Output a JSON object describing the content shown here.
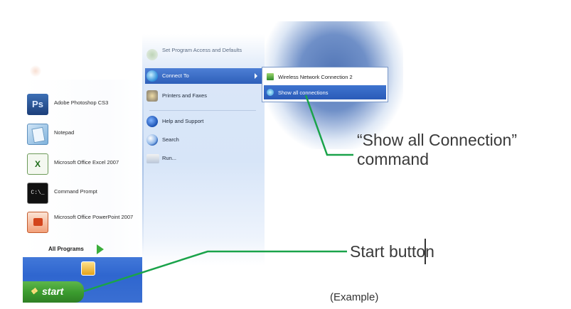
{
  "start_menu": {
    "pinned_programs": [
      {
        "label": "Adobe Photoshop CS3",
        "icon": "photoshop-icon",
        "glyph": "Ps"
      },
      {
        "label": "Notepad",
        "icon": "notepad-icon"
      },
      {
        "label": "Microsoft Office Excel 2007",
        "icon": "excel-icon",
        "glyph": "X"
      },
      {
        "label": "Command Prompt",
        "icon": "command-prompt-icon",
        "glyph": "C:\\_"
      },
      {
        "label": "Microsoft Office PowerPoint 2007",
        "icon": "powerpoint-icon"
      }
    ],
    "all_programs_label": "All Programs",
    "right_column": {
      "set_program_access": "Set Program Access and Defaults",
      "connect_to": "Connect To",
      "printers_and_faxes": "Printers and Faxes",
      "help_and_support": "Help and Support",
      "search": "Search",
      "run": "Run..."
    },
    "connect_to_submenu": [
      {
        "label": "Wireless Network Connection 2",
        "icon": "wireless-network-icon"
      },
      {
        "label": "Show all connections",
        "icon": "network-connections-icon",
        "highlighted": true
      }
    ]
  },
  "taskbar": {
    "start_label": "start",
    "start_flag": "❖"
  },
  "annotations": {
    "show_all_line1": "“Show all Connection”",
    "show_all_line2": "command",
    "start_button": "Start button",
    "example": "(Example)",
    "line_color": "#1aa34a"
  },
  "colors": {
    "xp_blue": "#2f66cf",
    "start_green": "#3a9a2e",
    "highlight_blue": "#2e5fb9"
  }
}
